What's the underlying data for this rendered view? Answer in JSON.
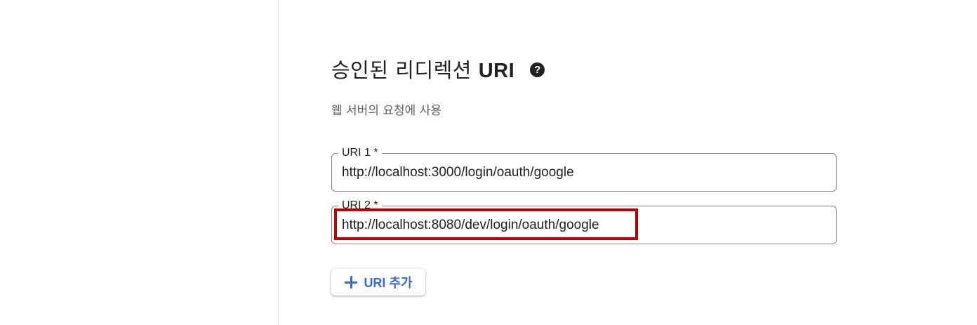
{
  "section": {
    "title_prefix": "승인된 리디렉션 ",
    "title_strong": "URI",
    "help_icon_glyph": "?",
    "subtitle": "웹 서버의 요청에 사용"
  },
  "fields": [
    {
      "label": "URI 1 *",
      "value": "http://localhost:3000/login/oauth/google"
    },
    {
      "label": "URI 2 *",
      "value": "http://localhost:8080/dev/login/oauth/google"
    }
  ],
  "add_button": {
    "label": "URI 추가",
    "icon": "plus-icon"
  },
  "colors": {
    "accent": "#3b69d4",
    "highlight": "#c00000",
    "text": "#202124",
    "secondary_text": "#5f6368"
  }
}
